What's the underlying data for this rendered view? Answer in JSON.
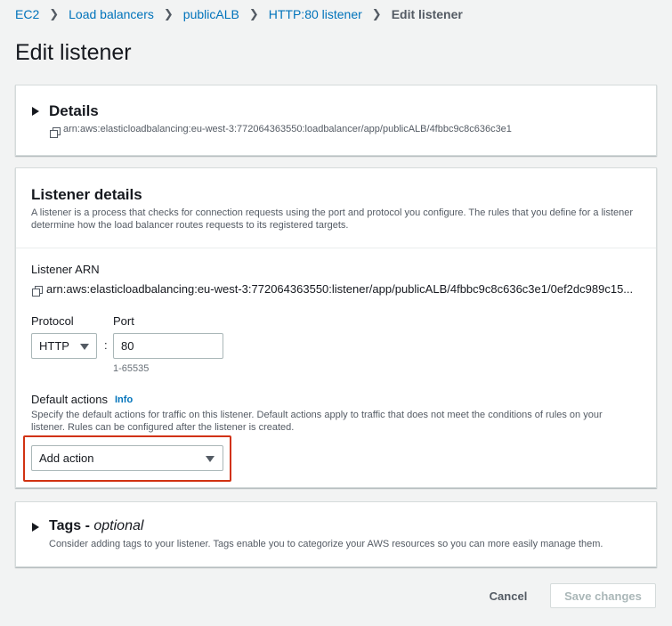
{
  "breadcrumb": {
    "items": [
      "EC2",
      "Load balancers",
      "publicALB",
      "HTTP:80 listener"
    ],
    "current": "Edit listener"
  },
  "page_title": "Edit listener",
  "details_panel": {
    "title": "Details",
    "arn": "arn:aws:elasticloadbalancing:eu-west-3:772064363550:loadbalancer/app/publicALB/4fbbc9c8c636c3e1"
  },
  "listener_panel": {
    "title": "Listener details",
    "description": "A listener is a process that checks for connection requests using the port and protocol you configure. The rules that you define for a listener determine how the load balancer routes requests to its registered targets.",
    "arn_label": "Listener ARN",
    "arn_value": "arn:aws:elasticloadbalancing:eu-west-3:772064363550:listener/app/publicALB/4fbbc9c8c636c3e1/0ef2dc989c15...",
    "protocol_label": "Protocol",
    "protocol_value": "HTTP",
    "port_label": "Port",
    "port_value": "80",
    "port_hint": "1-65535",
    "separator": ":",
    "default_actions_label": "Default actions",
    "info_link": "Info",
    "default_actions_description": "Specify the default actions for traffic on this listener. Default actions apply to traffic that does not meet the conditions of rules on your listener. Rules can be configured after the listener is created.",
    "add_action_label": "Add action"
  },
  "tags_panel": {
    "title": "Tags - ",
    "title_optional": "optional",
    "description": "Consider adding tags to your listener. Tags enable you to categorize your AWS resources so you can more easily manage them."
  },
  "footer": {
    "cancel_label": "Cancel",
    "save_label": "Save changes"
  },
  "colors": {
    "link": "#0073bb",
    "highlight": "#d13212",
    "background": "#f2f3f3"
  }
}
